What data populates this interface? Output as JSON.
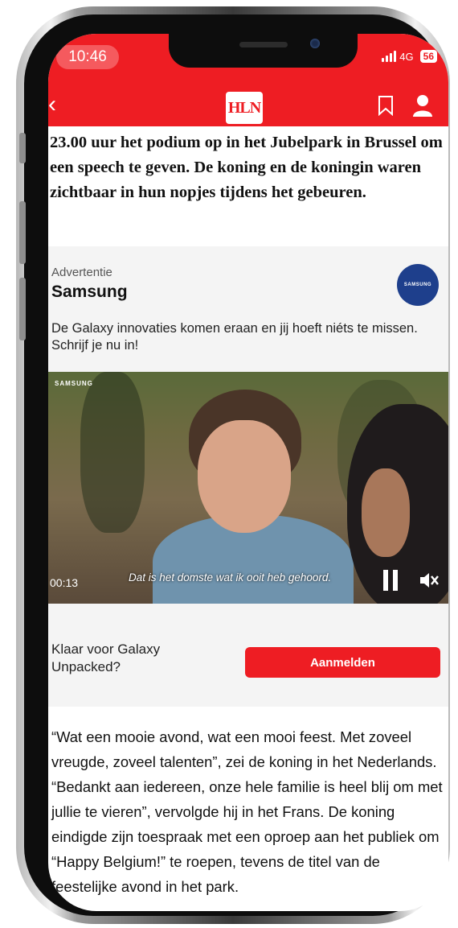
{
  "status_bar": {
    "time": "10:46",
    "network": "4G",
    "battery": "56"
  },
  "header": {
    "logo": "HLN"
  },
  "article": {
    "lead_text": "23.00 uur het podium op in het Jubelpark in Brussel om een speech te geven. De koning en de koningin waren zichtbaar in hun nopjes tijdens het gebeuren.",
    "body_text": "“Wat een mooie avond, wat een mooi feest. Met zoveel vreugde, zoveel talenten”, zei de koning in het Nederlands. “Bedankt aan iedereen, onze hele familie is heel blij om met jullie te vieren”, vervolgde hij in het Frans. De koning eindigde zijn toespraak met een oproep aan het publiek om “Happy Belgium!” te roepen, tevens de titel van de feestelijke avond in het park."
  },
  "ad": {
    "label": "Advertentie",
    "brand": "Samsung",
    "logo_text": "SAMSUNG",
    "text": "De Galaxy innovaties komen eraan en jij hoeft niéts te missen. Schrijf je nu in!",
    "video": {
      "brand": "SAMSUNG",
      "time": "00:13",
      "subtitle": "Dat is het domste wat ik ooit heb gehoord."
    },
    "cta_text": "Klaar voor Galaxy Unpacked?",
    "cta_button": "Aanmelden"
  },
  "icons": [
    "back-icon",
    "bookmark-icon",
    "user-icon",
    "pause-icon",
    "mute-icon",
    "signal-icon"
  ],
  "colors": {
    "brand_red": "#ee1d23",
    "samsung_blue": "#1e3f8c"
  }
}
